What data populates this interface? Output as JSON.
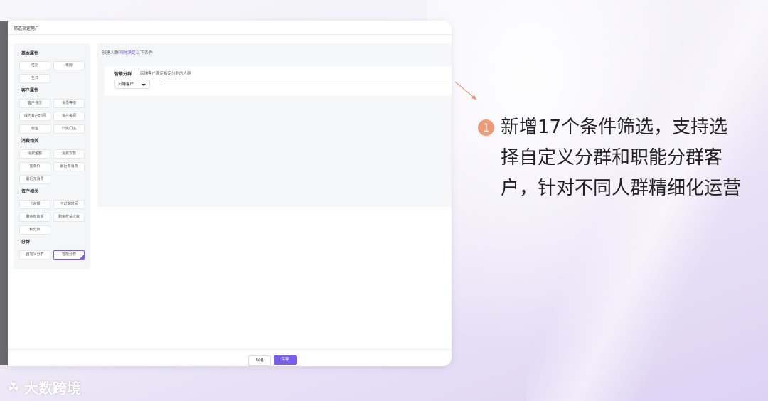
{
  "window": {
    "title": "筛选指定用户"
  },
  "sidebar": {
    "sections": [
      {
        "title": "基本属性",
        "items": [
          "性别",
          "年龄",
          "生日"
        ]
      },
      {
        "title": "客户属性",
        "items": [
          "客户身份",
          "会员等级",
          "成为客户时间",
          "客户来源",
          "标签",
          "归属门店"
        ]
      },
      {
        "title": "消费相关",
        "items": [
          "消费金额",
          "消费次数",
          "客单价",
          "最近有消费",
          "最近无消费"
        ]
      },
      {
        "title": "资产相关",
        "items": [
          "卡余额",
          "卡过期时间",
          "剩余有效额",
          "剩余权益次数",
          "积分数"
        ]
      },
      {
        "title": "分群",
        "items": [
          "自定义分群",
          "智能分群"
        ]
      }
    ],
    "active_item": "智能分群"
  },
  "main": {
    "header_prefix": "创建人群",
    "header_highlight": "同时满足",
    "header_suffix": "以下条件",
    "condition": {
      "label": "智能分群",
      "description": "店铺客户满足指定分群的人群",
      "select_value": "沉睡客户"
    }
  },
  "footer": {
    "cancel_label": "取消",
    "save_label": "保存"
  },
  "annotation": {
    "number": "1",
    "text": "新增17个条件筛选，支持选择自定义分群和职能分群客户，针对不同人群精细化运营"
  },
  "watermark": {
    "text": "大数跨境"
  },
  "colors": {
    "accent": "#7b5cf0",
    "annotation": "#f29974"
  }
}
